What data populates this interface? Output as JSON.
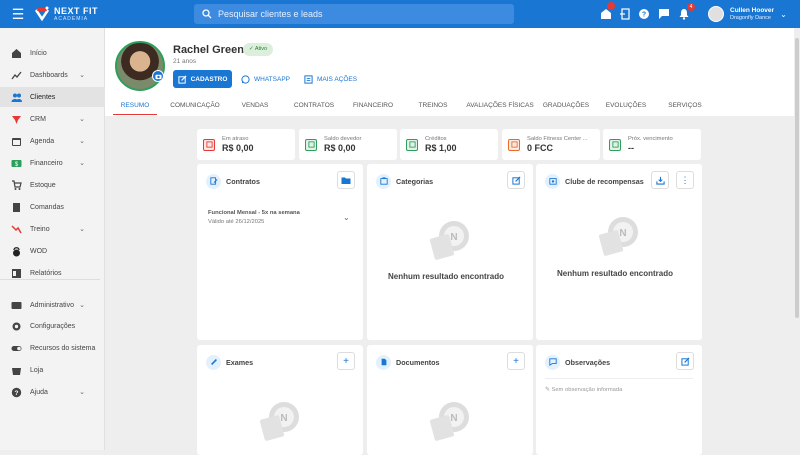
{
  "app": {
    "brand": "NEXT FIT",
    "brand_sub": "ACADEMIA"
  },
  "search": {
    "placeholder": "Pesquisar clientes e leads"
  },
  "topbar": {
    "notification_count": "4"
  },
  "user": {
    "name": "Cullen Hoover",
    "company": "Dragonfly Dance"
  },
  "sidebar": {
    "items": [
      {
        "label": "Início",
        "icon": "home-icon"
      },
      {
        "label": "Dashboards",
        "icon": "chart-icon"
      },
      {
        "label": "Clientes",
        "icon": "people-icon"
      },
      {
        "label": "CRM",
        "icon": "crm-icon"
      },
      {
        "label": "Agenda",
        "icon": "calendar-icon"
      },
      {
        "label": "Financeiro",
        "icon": "money-icon"
      },
      {
        "label": "Estoque",
        "icon": "cart-icon"
      },
      {
        "label": "Comandas",
        "icon": "receipt-icon"
      },
      {
        "label": "Treino",
        "icon": "trend-icon"
      },
      {
        "label": "WOD",
        "icon": "kettlebell-icon"
      },
      {
        "label": "Relatórios",
        "icon": "report-icon"
      },
      {
        "label": "Administrativo",
        "icon": "admin-icon"
      },
      {
        "label": "Configurações",
        "icon": "gear-icon"
      },
      {
        "label": "Recursos do sistema",
        "icon": "toggle-icon"
      },
      {
        "label": "Loja",
        "icon": "bag-icon"
      },
      {
        "label": "Ajuda",
        "icon": "help-icon"
      }
    ]
  },
  "client": {
    "name": "Rachel Green",
    "status": "Ativo",
    "age": "21 anos",
    "btn_cadastro": "CADASTRO",
    "btn_whatsapp": "WHATSAPP",
    "btn_more": "MAIS AÇÕES"
  },
  "tabs": [
    "RESUMO",
    "COMUNICAÇÃO",
    "VENDAS",
    "CONTRATOS",
    "FINANCEIRO",
    "TREINOS",
    "AVALIAÇÕES FÍSICAS",
    "GRADUAÇÕES",
    "EVOLUÇÕES",
    "SERVIÇOS"
  ],
  "kpis": [
    {
      "label": "Em atraso",
      "value": "R$ 0,00",
      "color": "#e53935"
    },
    {
      "label": "Saldo devedor",
      "value": "R$ 0,00",
      "color": "#2e9e5b"
    },
    {
      "label": "Créditos",
      "value": "R$ 1,00",
      "color": "#2e9e5b"
    },
    {
      "label": "Saldo Fitness Center ...",
      "value": "0 FCC",
      "color": "#e86a2a"
    },
    {
      "label": "Próx. vencimento",
      "value": "--",
      "color": "#2e9e5b"
    }
  ],
  "cards": {
    "contratos": {
      "title": "Contratos",
      "plan": "Funcional Mensal - 5x na semana",
      "valid": "Válido até 26/12/2025"
    },
    "categorias": {
      "title": "Categorias",
      "empty": "Nenhum resultado encontrado"
    },
    "clube": {
      "title": "Clube de recompensas",
      "empty": "Nenhum resultado encontrado"
    },
    "exames": {
      "title": "Exames"
    },
    "documentos": {
      "title": "Documentos"
    },
    "observacoes": {
      "title": "Observações",
      "empty": "Sem observação informada"
    }
  },
  "colors": {
    "primary": "#1976d2",
    "accent_red": "#e53935",
    "green": "#2e9e5b"
  }
}
